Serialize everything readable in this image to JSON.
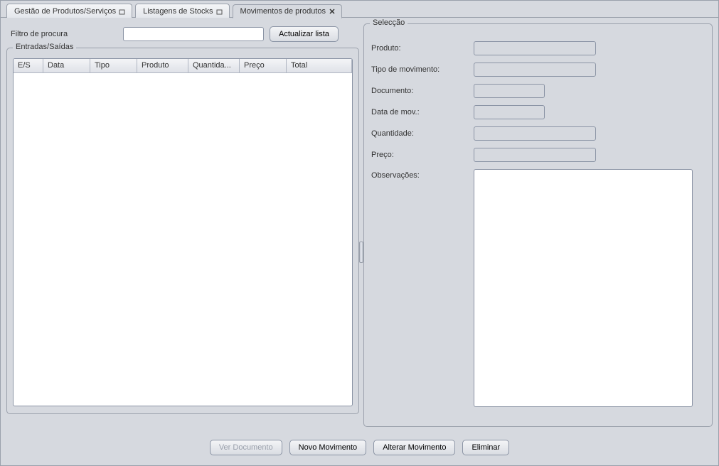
{
  "tabs": [
    {
      "label": "Gestão de Produtos/Serviços",
      "active": false
    },
    {
      "label": "Listagens de Stocks",
      "active": false
    },
    {
      "label": "Movimentos de produtos",
      "active": true
    }
  ],
  "filter": {
    "label": "Filtro de procura",
    "value": "",
    "refresh_button": "Actualizar lista"
  },
  "entradas": {
    "title": "Entradas/Saídas",
    "columns": [
      "E/S",
      "Data",
      "Tipo",
      "Produto",
      "Quantida...",
      "Preço",
      "Total"
    ],
    "rows": []
  },
  "selection": {
    "title": "Selecção",
    "fields": {
      "produto": {
        "label": "Produto:",
        "value": ""
      },
      "tipo_mov": {
        "label": "Tipo de movimento:",
        "value": ""
      },
      "documento": {
        "label": "Documento:",
        "value": ""
      },
      "data_mov": {
        "label": "Data de mov.:",
        "value": ""
      },
      "quantidade": {
        "label": "Quantidade:",
        "value": ""
      },
      "preco": {
        "label": "Preço:",
        "value": ""
      },
      "observacoes": {
        "label": "Observações:",
        "value": ""
      }
    }
  },
  "buttons": {
    "ver_documento": "Ver Documento",
    "novo_movimento": "Novo Movimento",
    "alterar_movimento": "Alterar Movimento",
    "eliminar": "Eliminar"
  }
}
